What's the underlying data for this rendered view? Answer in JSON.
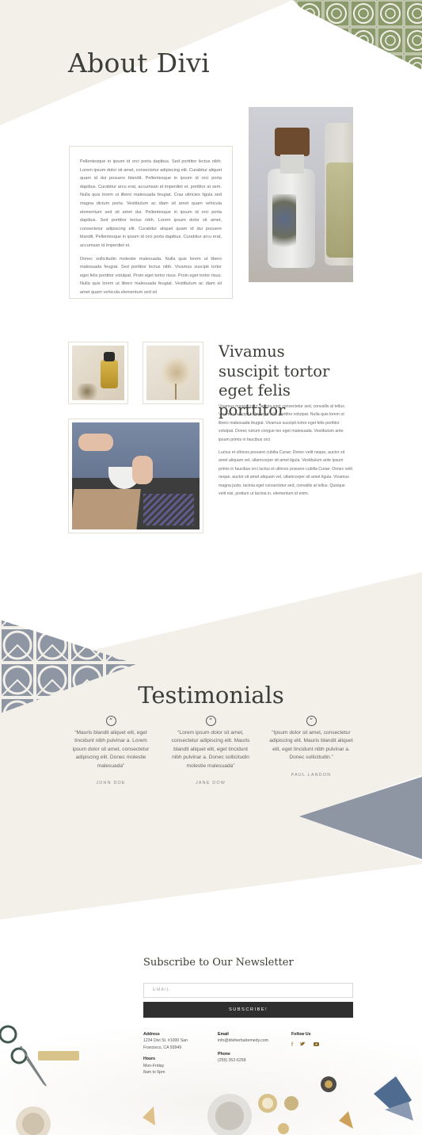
{
  "about": {
    "title": "About Divi",
    "paragraph1": "Pellentesque in ipsum id orci porta dapibus. Sed porttitor lectus nibh. Lorem ipsum dolor sit amet, consectetur adipiscing elit. Curabitur aliquet quam id dui posuere blandit. Pellentesque in ipsum id orci porta dapibus. Curabitur arcu erat, accumsan id imperdiet et, porttitor at sem. Nulla quis lorem ut libero malesuada feugiat. Cras ultricies ligula sed magna dictum porta. Vestibulum ac diam sit amet quam vehicula elementum sed sit amet dui. Pellentesque in ipsum id orci porta dapibus. Sed porttitor lectus nibh. Lorem ipsum dolor sit amet, consectetur adipiscing elit. Curabitur aliquet quam id dui posuere blandit. Pellentesque in ipsum id orci porta dapibus. Curabitur arcu erat, accumsan id imperdiet et.",
    "paragraph2": "Donec sollicitudin molestie malesuada. Nulla quis lorem ut libero malesuada feugiat. Sed porttitor lectus nibh. Vivamus suscipit tortor eget felis porttitor volutpat. Proin eget tortor risus. Proin eget tortor risus. Nulla quis lorem ut libero malesuada feugiat. Vestibulum ac diam sit amet quam vehicula elementum sed sit"
  },
  "feature": {
    "title": "Vivamus suscipit tortor eget felis porttitor",
    "paragraph1": "Vivamus magna justo, lacinia eget consectetur sed, convallis at tellus. Vivamus suscipit tortor eget felis porttitor volutpat. Nulla quis lorem ut libero malesuada feugiat. Vivamus suscipit tortor eget felis porttitor volutpat. Donec rutrum congue leo eget malesuada. Vestibulum ante ipsum primis in faucibus orci",
    "paragraph2": "Luctus et ultrices posuere cubilia Curae; Donec velit neque, auctor sit amet aliquam vel, ullamcorper sit amet ligula. Vestibulum ante ipsum primis in faucibus orci luctus et ultrices posuere cubilia Curae; Donec velit neque, auctor sit amet aliquam vel, ullamcorper sit amet ligula. Vivamus magna justo, lacinia eget consectetur sed, convallis at tellus. Quisque velit nisi, pretium ut lacinia in, elementum id enim."
  },
  "testimonials": {
    "title": "Testimonials",
    "items": [
      {
        "quote": "“Mauris blandit aliquet elit, eget tincidunt nibh pulvinar a. Lorem ipsum dolor sit amet, consectetur adipiscing elit. Donec molestie malesuada”",
        "name": "JOHN DOE"
      },
      {
        "quote": "“Lorem ipsum dolor sit amet, consectetur adipiscing elit. Mauris blandit aliquet elit, eget tincidunt nibh pulvinar a. Donec sollicitudin molestie malesuada”",
        "name": "JANE DOW"
      },
      {
        "quote": "“Ipsum dolor sit amet, consectetur adipiscing elit. Mauris blandit aliquet elit, eget tincidunt nibh pulvinar a. Donec sollicitudin.”",
        "name": "PAUL LANDON"
      }
    ]
  },
  "newsletter": {
    "title": "Subscribe to Our Newsletter",
    "email_placeholder": "EMAIL",
    "button_label": "SUBSCRIBE!"
  },
  "contact": {
    "address_label": "Address",
    "address_line1": "1234 Divi St. #1000 San",
    "address_line2": "Francisco, CA 93949",
    "hours_label": "Hours",
    "hours_line1": "Mon-Friday",
    "hours_line2": "8am to 5pm",
    "email_label": "Email",
    "email_value": "info@diviherbalremedy.com",
    "phone_label": "Phone",
    "phone_value": "(255) 352-6258",
    "follow_label": "Follow Us"
  },
  "colors": {
    "cream": "#f3efe9",
    "sage": "#8a9a6b",
    "slate": "#8e96a4",
    "dark_button": "#2f2f2f"
  },
  "icons": [
    "quote-icon",
    "facebook-icon",
    "twitter-icon",
    "youtube-icon"
  ]
}
